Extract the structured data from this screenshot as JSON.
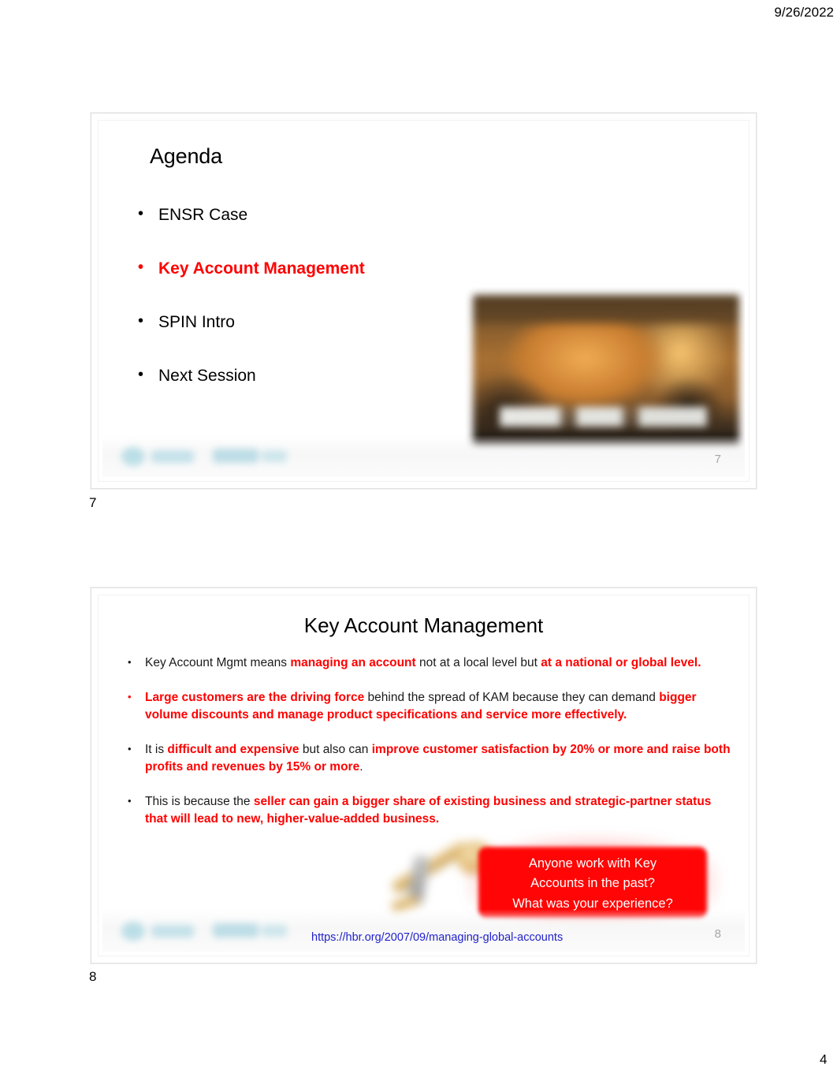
{
  "document": {
    "date": "9/26/2022",
    "corner_page_number": "4"
  },
  "slides": [
    {
      "handout_number": "7",
      "slide_number": "7",
      "title": "Agenda",
      "bullets": [
        {
          "text": "ENSR Case",
          "highlighted": false
        },
        {
          "text": "Key Account Management",
          "highlighted": true
        },
        {
          "text": "SPIN Intro",
          "highlighted": false
        },
        {
          "text": "Next Session",
          "highlighted": false
        }
      ],
      "image": "blurred-video-thumbnail"
    },
    {
      "handout_number": "8",
      "slide_number": "8",
      "title": "Key Account Management",
      "bullets": [
        {
          "bullet_color": "black",
          "runs": [
            {
              "text": "Key Account Mgmt means ",
              "red": false
            },
            {
              "text": "managing an account",
              "red": true
            },
            {
              "text": " not at a local level but ",
              "red": false
            },
            {
              "text": "at a national or global level.",
              "red": true
            }
          ]
        },
        {
          "bullet_color": "red",
          "runs": [
            {
              "text": "Large customers are the driving force",
              "red": true
            },
            {
              "text": " behind the spread of KAM because they can demand ",
              "red": false
            },
            {
              "text": "bigger volume discounts and manage product specifications and service more effectively.",
              "red": true
            }
          ]
        },
        {
          "bullet_color": "black",
          "runs": [
            {
              "text": "It is ",
              "red": false
            },
            {
              "text": "difficult and expensive",
              "red": true
            },
            {
              "text": " but also can ",
              "red": false
            },
            {
              "text": "improve customer satisfaction by 20% or more and raise both profits and revenues by 15% or more",
              "red": true
            },
            {
              "text": ".",
              "red": false
            }
          ]
        },
        {
          "bullet_color": "black",
          "runs": [
            {
              "text": "This is because the ",
              "red": false
            },
            {
              "text": "seller can gain a bigger share of existing business and strategic-partner status that will lead to new, higher-value-added business.",
              "red": true
            }
          ]
        }
      ],
      "callout": {
        "line1": "Anyone work with Key",
        "line2": "Accounts in the past?",
        "line3": "What was your experience?",
        "background_color": "#FF0505",
        "text_color": "#FFFFFF"
      },
      "link": {
        "text": "https://hbr.org/2007/09/managing-global-accounts",
        "color": "#2222CC"
      },
      "image": "blurred-golden-key"
    }
  ],
  "colors": {
    "highlight_red": "#FF0000",
    "link_blue": "#2222CC",
    "slide_number_gray": "#A6A6A6",
    "watermark_blue": "#A8D6E2"
  }
}
